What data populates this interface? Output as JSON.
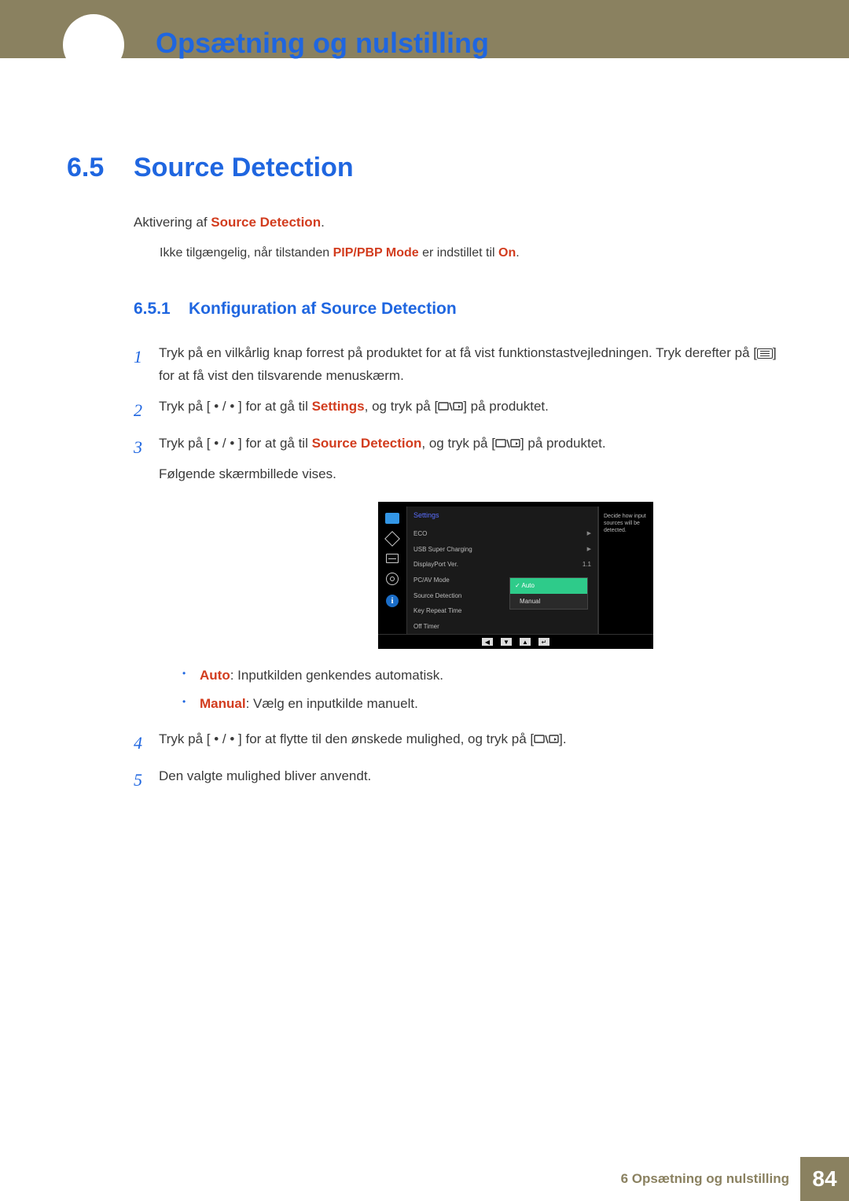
{
  "header": {
    "chapter_title": "Opsætning og nulstilling"
  },
  "section": {
    "number": "6.5",
    "title": "Source Detection"
  },
  "intro": {
    "prefix": "Aktivering af ",
    "highlight": "Source Detection",
    "suffix": "."
  },
  "note": {
    "prefix": "Ikke tilgængelig, når tilstanden ",
    "h1": "PIP/PBP Mode",
    "mid": " er indstillet til ",
    "h2": "On",
    "suffix": "."
  },
  "subsection": {
    "number": "6.5.1",
    "title": "Konfiguration af Source Detection"
  },
  "steps": {
    "s1": {
      "num": "1",
      "a": "Tryk på en vilkårlig knap forrest på produktet for at få vist funktionstastvejledningen. Tryk derefter på [",
      "b": "] for at få vist den tilsvarende menuskærm."
    },
    "s2": {
      "num": "2",
      "a": "Tryk på [",
      "dots": " • / • ",
      "b": "] for at gå til ",
      "hi": "Settings",
      "c": ", og tryk på [",
      "d": "] på produktet."
    },
    "s3": {
      "num": "3",
      "a": "Tryk på [",
      "dots": " • / • ",
      "b": "] for at gå til ",
      "hi": "Source Detection",
      "c": ", og tryk på [",
      "d": "] på produktet.",
      "e": "Følgende skærmbillede vises."
    },
    "s4": {
      "num": "4",
      "a": "Tryk på [",
      "dots": " • / • ",
      "b": "] for at flytte til den ønskede mulighed, og tryk på [",
      "c": "]."
    },
    "s5": {
      "num": "5",
      "text": "Den valgte mulighed bliver anvendt."
    }
  },
  "osd": {
    "title": "Settings",
    "items": {
      "eco": "ECO",
      "usb": "USB Super Charging",
      "dp": "DisplayPort Ver.",
      "dp_val": "1.1",
      "pcav": "PC/AV Mode",
      "src": "Source Detection",
      "krt": "Key Repeat Time",
      "off": "Off Timer"
    },
    "popup": {
      "auto": "Auto",
      "manual": "Manual"
    },
    "help": "Decide how input sources will be detected.",
    "info_glyph": "i"
  },
  "bullets": {
    "auto": {
      "hi": "Auto",
      "text": ": Inputkilden genkendes automatisk."
    },
    "manual": {
      "hi": "Manual",
      "text": ": Vælg en inputkilde manuelt."
    }
  },
  "footer": {
    "text": "6 Opsætning og nulstilling",
    "page": "84"
  }
}
